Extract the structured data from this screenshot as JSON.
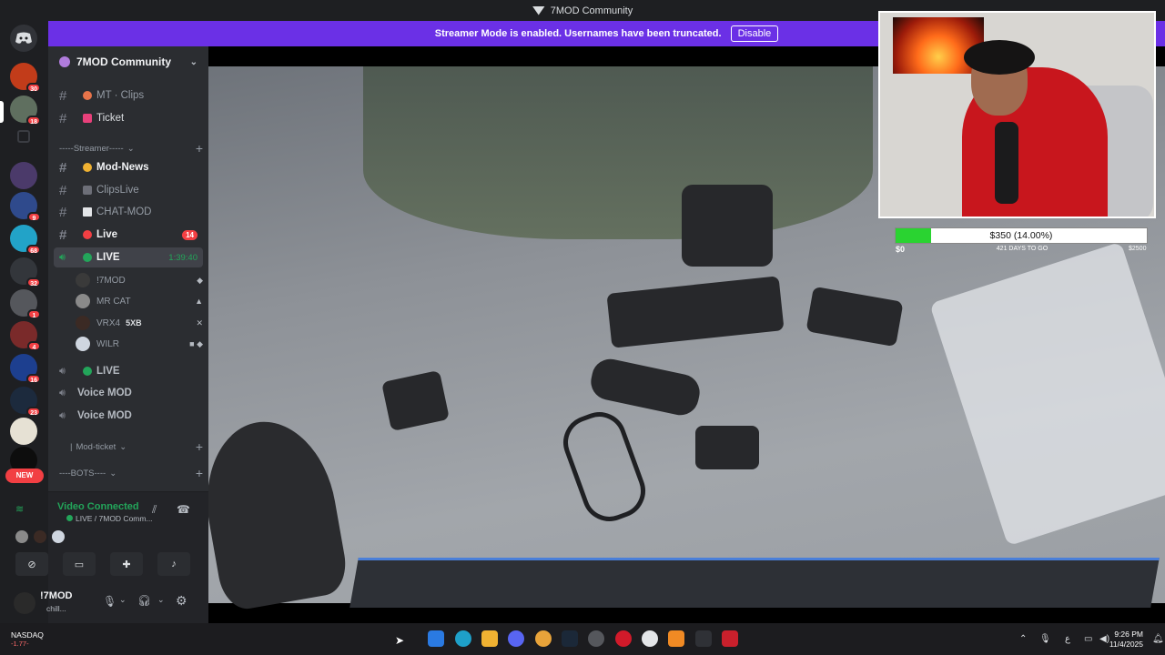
{
  "window": {
    "title": "7MOD Community"
  },
  "banner": {
    "text": "Streamer Mode is enabled. Usernames have been truncated.",
    "button": "Disable"
  },
  "server_rail": {
    "badges": [
      "30",
      "18",
      "9",
      "68",
      "32",
      "1",
      "4",
      "16",
      "23"
    ],
    "new_label": "NEW"
  },
  "sidebar": {
    "guild_name": "7MOD Community",
    "channels_top": [
      {
        "label": "MT · Clips",
        "color": "#e8744a"
      },
      {
        "label": "Ticket",
        "color": "#e8407a"
      }
    ],
    "streamer_category": "-----Streamer-----",
    "streamer_channels": [
      {
        "label": "Mod-News",
        "bold": true
      },
      {
        "label": "ClipsLive"
      },
      {
        "label": "CHAT-MOD"
      },
      {
        "label": "Live",
        "bold": true,
        "badge": "14"
      }
    ],
    "live_channel": {
      "label": "LIVE",
      "timer": "1:39:40"
    },
    "voice_users": [
      {
        "name": "!7MOD"
      },
      {
        "name": "MR CAT"
      },
      {
        "name": "VRX4",
        "tag": "5XB"
      },
      {
        "name": "WILR"
      }
    ],
    "voice_channels": [
      "LIVE",
      "Voice MOD",
      "Voice MOD"
    ],
    "mod_category": "Mod-ticket",
    "bots_category": "----BOTS----"
  },
  "voice_panel": {
    "status": "Video Connected",
    "location": "LIVE / 7MOD Comm...",
    "user_name": "!7MOD",
    "user_status": "chill..."
  },
  "overlay": {
    "goal_text": "$350 (14.00%)",
    "goal_progress": 0.14,
    "goal_min": "$0",
    "goal_max": "$2500",
    "days_left": "421 DAYS TO GO"
  },
  "taskbar": {
    "ticker_name": "NASDAQ",
    "ticker_value": "-1.77-",
    "time": "9:26 PM",
    "date": "11/4/2025",
    "lang": "ع"
  },
  "colors": {
    "accent": "#6b30e6",
    "online": "#23a55a",
    "badge": "#f23f43"
  }
}
